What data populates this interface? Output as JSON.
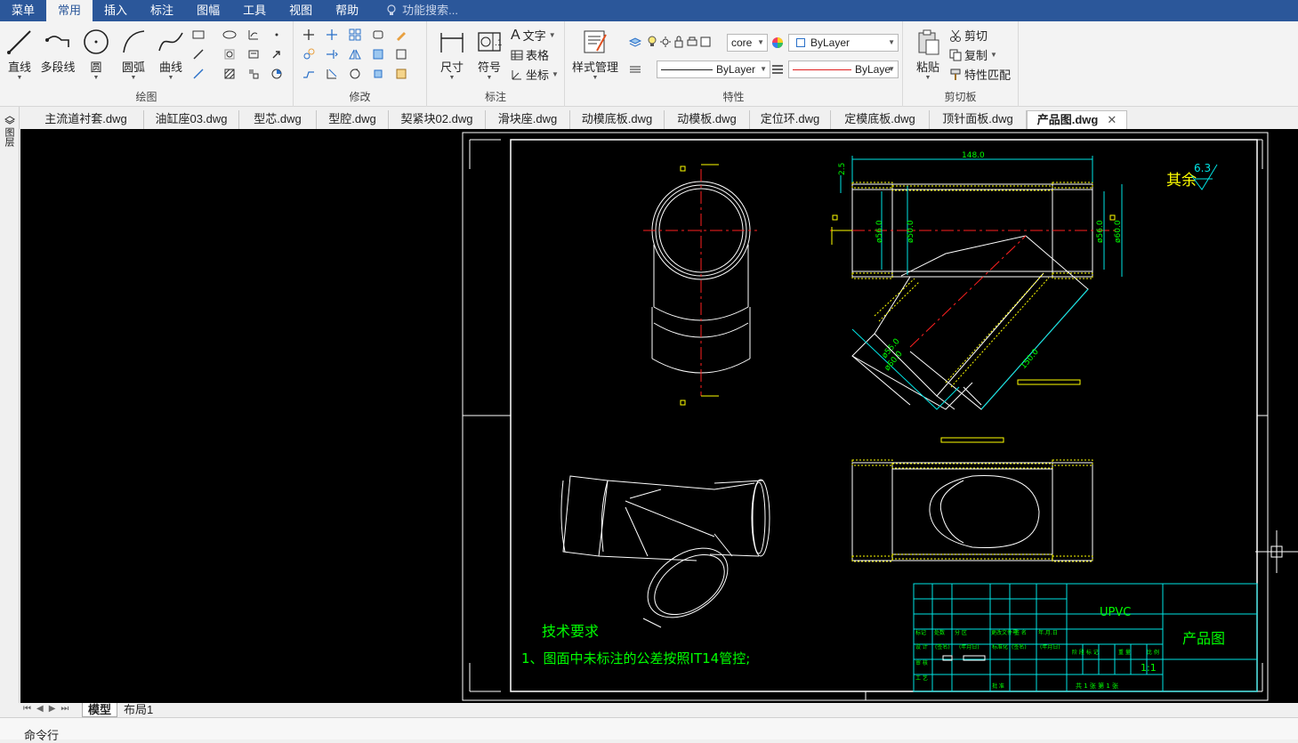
{
  "menu": {
    "items": [
      "菜单",
      "常用",
      "插入",
      "标注",
      "图幅",
      "工具",
      "视图",
      "帮助"
    ],
    "active_index": 1,
    "search_placeholder": "功能搜索..."
  },
  "ribbon": {
    "draw": {
      "label": "绘图",
      "line": "直线",
      "polyline": "多段线",
      "circle": "圆",
      "arc": "圆弧",
      "curve": "曲线"
    },
    "modify": {
      "label": "修改"
    },
    "annotate": {
      "label": "标注",
      "dimension": "尺寸",
      "symbol": "符号",
      "text": "文字",
      "table": "表格",
      "coordinate": "坐标"
    },
    "properties": {
      "label": "特性",
      "style_manager": "样式管理",
      "layer_value": "core",
      "color_value": "ByLayer",
      "linetype_value": "ByLayer",
      "lineweight_value": "ByLayе"
    },
    "clipboard": {
      "label": "剪切板",
      "paste": "粘贴",
      "cut": "剪切",
      "copy": "复制",
      "match": "特性匹配"
    }
  },
  "tabs": [
    {
      "label": "主流道衬套.dwg",
      "active": false
    },
    {
      "label": "油缸座03.dwg",
      "active": false
    },
    {
      "label": "型芯.dwg",
      "active": false
    },
    {
      "label": "型腔.dwg",
      "active": false
    },
    {
      "label": "契紧块02.dwg",
      "active": false
    },
    {
      "label": "滑块座.dwg",
      "active": false
    },
    {
      "label": "动模底板.dwg",
      "active": false
    },
    {
      "label": "动模板.dwg",
      "active": false
    },
    {
      "label": "定位环.dwg",
      "active": false
    },
    {
      "label": "定模底板.dwg",
      "active": false
    },
    {
      "label": "顶针面板.dwg",
      "active": false
    },
    {
      "label": "产品图.dwg",
      "active": true
    }
  ],
  "left_toolbar": {
    "label": "图层"
  },
  "drawing": {
    "dim_length": "148.0",
    "dim_left_1": "ø56.0",
    "dim_left_2": "ø50.0",
    "dim_right_1": "ø56.0",
    "dim_right_2": "ø60.0",
    "dim_top_small": "2.5",
    "dim_branch_len": "150.0",
    "dim_branch_1": "ø55.0",
    "dim_branch_2": "ø60.0",
    "roughness_prefix": "其余",
    "roughness_value": "6.3",
    "tech_title": "技术要求",
    "tech_note": "1、图面中未标注的公差按照IT14管控;",
    "title_block": {
      "material": "UPVC",
      "name": "产品图",
      "scale": "1:1",
      "sheet": "共 1 张   第 1 张",
      "row_headers": [
        "标记",
        "处数",
        "分 区",
        "更改文件号",
        "签 名",
        "年.月.日"
      ],
      "row_design": [
        "设 计",
        "(签名)",
        "(年月日)",
        "标准化",
        "(签名)",
        "(年月日)"
      ],
      "stage_headers": [
        "阶 段 标 记",
        "重 量",
        "比 例"
      ],
      "audit": "审 核",
      "process": "工 艺",
      "approve": "批 准"
    }
  },
  "layout_tabs": [
    {
      "label": "模型",
      "active": true
    },
    {
      "label": "布局1",
      "active": false
    }
  ],
  "command": {
    "label": "命令行"
  },
  "colors": {
    "menubar": "#2b579a",
    "canvas": "#000000",
    "cad_white": "#ffffff",
    "cad_yellow": "#ffff00",
    "cad_cyan": "#00e5e5",
    "cad_red": "#ff2020",
    "cad_green": "#00ff00"
  }
}
